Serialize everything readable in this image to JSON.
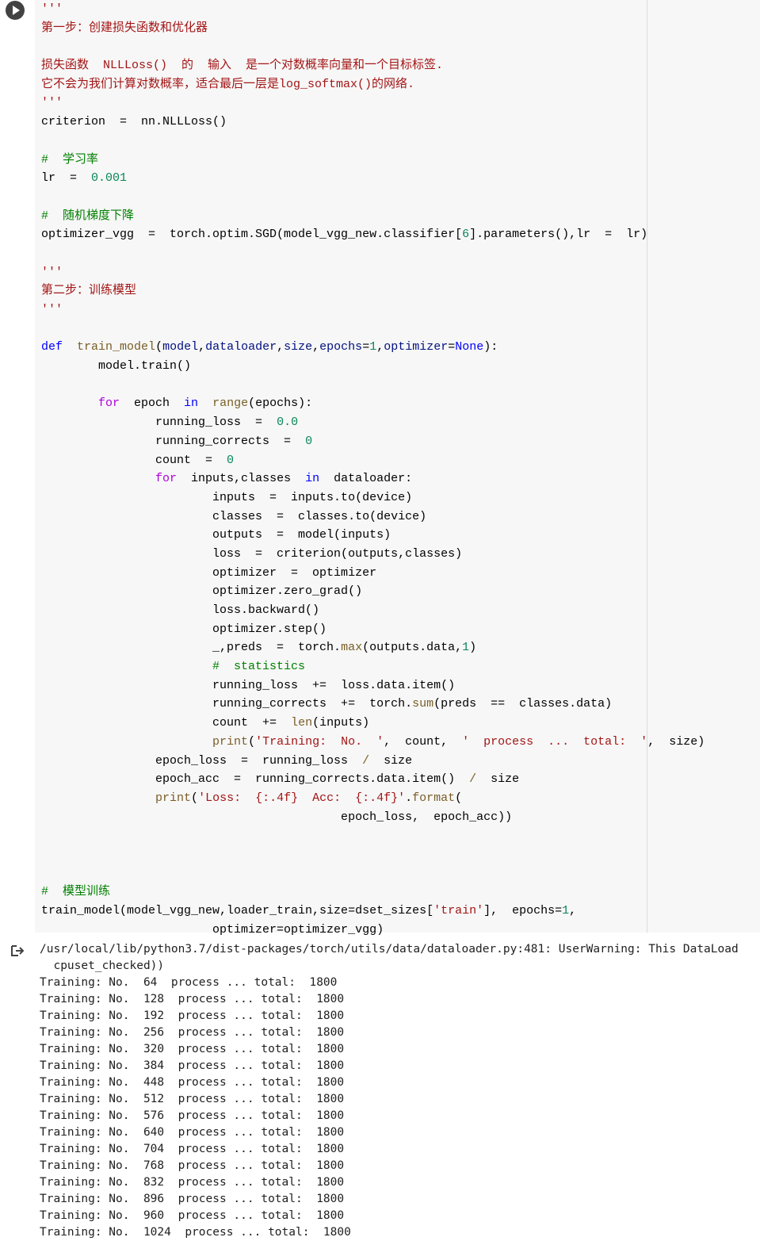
{
  "cell": {
    "run_label": "run",
    "lines": [
      [
        {
          "t": "'''",
          "c": "str"
        }
      ],
      [
        {
          "t": "第一步：创建损失函数和优化器",
          "c": "str"
        }
      ],
      [
        {
          "t": "",
          "c": ""
        }
      ],
      [
        {
          "t": "损失函数  NLLLoss()  的  输入  是一个对数概率向量和一个目标标签.",
          "c": "str"
        }
      ],
      [
        {
          "t": "它不会为我们计算对数概率，适合最后一层是log_softmax()的网络.",
          "c": "str"
        }
      ],
      [
        {
          "t": "'''",
          "c": "str"
        }
      ],
      [
        {
          "t": "criterion  =  nn.NLLLoss()",
          "c": ""
        }
      ],
      [
        {
          "t": "",
          "c": ""
        }
      ],
      [
        {
          "t": "#  学习率",
          "c": "cm"
        }
      ],
      [
        {
          "t": "lr  =  ",
          "c": ""
        },
        {
          "t": "0.001",
          "c": "num"
        }
      ],
      [
        {
          "t": "",
          "c": ""
        }
      ],
      [
        {
          "t": "#  随机梯度下降",
          "c": "cm"
        }
      ],
      [
        {
          "t": "optimizer_vgg  =  torch.optim.SGD(model_vgg_new.classifier[",
          "c": ""
        },
        {
          "t": "6",
          "c": "num"
        },
        {
          "t": "].parameters(),lr  =  lr)",
          "c": ""
        }
      ],
      [
        {
          "t": "",
          "c": ""
        }
      ],
      [
        {
          "t": "'''",
          "c": "str"
        }
      ],
      [
        {
          "t": "第二步：训练模型",
          "c": "str"
        }
      ],
      [
        {
          "t": "'''",
          "c": "str"
        }
      ],
      [
        {
          "t": "",
          "c": ""
        }
      ],
      [
        {
          "t": "def",
          "c": "kw"
        },
        {
          "t": "  ",
          "c": ""
        },
        {
          "t": "train_model",
          "c": "fn"
        },
        {
          "t": "(",
          "c": ""
        },
        {
          "t": "model",
          "c": "par"
        },
        {
          "t": ",",
          "c": ""
        },
        {
          "t": "dataloader",
          "c": "par"
        },
        {
          "t": ",",
          "c": ""
        },
        {
          "t": "size",
          "c": "par"
        },
        {
          "t": ",",
          "c": ""
        },
        {
          "t": "epochs",
          "c": "par"
        },
        {
          "t": "=",
          "c": ""
        },
        {
          "t": "1",
          "c": "num"
        },
        {
          "t": ",",
          "c": ""
        },
        {
          "t": "optimizer",
          "c": "par"
        },
        {
          "t": "=",
          "c": ""
        },
        {
          "t": "None",
          "c": "kw"
        },
        {
          "t": "):",
          "c": ""
        }
      ],
      [
        {
          "t": "        model.train()",
          "c": ""
        }
      ],
      [
        {
          "t": "",
          "c": ""
        }
      ],
      [
        {
          "t": "        ",
          "c": ""
        },
        {
          "t": "for",
          "c": "kw2"
        },
        {
          "t": "  epoch  ",
          "c": ""
        },
        {
          "t": "in",
          "c": "kw"
        },
        {
          "t": "  ",
          "c": ""
        },
        {
          "t": "range",
          "c": "fn"
        },
        {
          "t": "(epochs):",
          "c": ""
        }
      ],
      [
        {
          "t": "                running_loss  =  ",
          "c": ""
        },
        {
          "t": "0.0",
          "c": "num"
        }
      ],
      [
        {
          "t": "                running_corrects  =  ",
          "c": ""
        },
        {
          "t": "0",
          "c": "num"
        }
      ],
      [
        {
          "t": "                count  =  ",
          "c": ""
        },
        {
          "t": "0",
          "c": "num"
        }
      ],
      [
        {
          "t": "                ",
          "c": ""
        },
        {
          "t": "for",
          "c": "kw2"
        },
        {
          "t": "  inputs,classes  ",
          "c": ""
        },
        {
          "t": "in",
          "c": "kw"
        },
        {
          "t": "  dataloader:",
          "c": ""
        }
      ],
      [
        {
          "t": "                        inputs  =  inputs.to(device)",
          "c": ""
        }
      ],
      [
        {
          "t": "                        classes  =  classes.to(device)",
          "c": ""
        }
      ],
      [
        {
          "t": "                        outputs  =  model(inputs)",
          "c": ""
        }
      ],
      [
        {
          "t": "                        loss  =  criterion(outputs,classes)",
          "c": ""
        }
      ],
      [
        {
          "t": "                        optimizer  =  optimizer",
          "c": ""
        }
      ],
      [
        {
          "t": "                        optimizer.zero_grad()",
          "c": ""
        }
      ],
      [
        {
          "t": "                        loss.backward()",
          "c": ""
        }
      ],
      [
        {
          "t": "                        optimizer.step()",
          "c": ""
        }
      ],
      [
        {
          "t": "                        _,preds  =  torch.",
          "c": ""
        },
        {
          "t": "max",
          "c": "fn"
        },
        {
          "t": "(outputs.data,",
          "c": ""
        },
        {
          "t": "1",
          "c": "num"
        },
        {
          "t": ")",
          "c": ""
        }
      ],
      [
        {
          "t": "                        #  statistics",
          "c": "cm"
        }
      ],
      [
        {
          "t": "                        running_loss  +=  loss.data.item()",
          "c": ""
        }
      ],
      [
        {
          "t": "                        running_corrects  +=  torch.",
          "c": ""
        },
        {
          "t": "sum",
          "c": "fn"
        },
        {
          "t": "(preds  ==  classes.data)",
          "c": ""
        }
      ],
      [
        {
          "t": "                        count  +=  ",
          "c": ""
        },
        {
          "t": "len",
          "c": "fn"
        },
        {
          "t": "(inputs)",
          "c": ""
        }
      ],
      [
        {
          "t": "                        ",
          "c": ""
        },
        {
          "t": "print",
          "c": "fn"
        },
        {
          "t": "(",
          "c": ""
        },
        {
          "t": "'Training:  No.  '",
          "c": "str"
        },
        {
          "t": ",  count,  ",
          "c": ""
        },
        {
          "t": "'  process  ...  total:  '",
          "c": "str"
        },
        {
          "t": ",  size)",
          "c": ""
        }
      ],
      [
        {
          "t": "                epoch_loss  =  running_loss  ",
          "c": ""
        },
        {
          "t": "/",
          "c": "fn"
        },
        {
          "t": "  size",
          "c": ""
        }
      ],
      [
        {
          "t": "                epoch_acc  =  running_corrects.data.item()  ",
          "c": ""
        },
        {
          "t": "/",
          "c": "fn"
        },
        {
          "t": "  size",
          "c": ""
        }
      ],
      [
        {
          "t": "                ",
          "c": ""
        },
        {
          "t": "print",
          "c": "fn"
        },
        {
          "t": "(",
          "c": ""
        },
        {
          "t": "'Loss:  {:.4f}  Acc:  {:.4f}'",
          "c": "str"
        },
        {
          "t": ".",
          "c": ""
        },
        {
          "t": "format",
          "c": "fn"
        },
        {
          "t": "(",
          "c": ""
        }
      ],
      [
        {
          "t": "                                          epoch_loss,  epoch_acc))",
          "c": ""
        }
      ],
      [
        {
          "t": "",
          "c": ""
        }
      ],
      [
        {
          "t": "",
          "c": ""
        }
      ],
      [
        {
          "t": "",
          "c": ""
        }
      ],
      [
        {
          "t": "#  模型训练",
          "c": "cm"
        }
      ],
      [
        {
          "t": "train_model(model_vgg_new,loader_train,size=dset_sizes[",
          "c": ""
        },
        {
          "t": "'train'",
          "c": "str"
        },
        {
          "t": "],  epochs=",
          "c": ""
        },
        {
          "t": "1",
          "c": "num"
        },
        {
          "t": ",",
          "c": ""
        }
      ],
      [
        {
          "t": "                        optimizer=optimizer_vgg)",
          "c": ""
        }
      ]
    ]
  },
  "output": {
    "icon": "output-redirect-icon",
    "lines": [
      "/usr/local/lib/python3.7/dist-packages/torch/utils/data/dataloader.py:481: UserWarning: This DataLoad",
      "  cpuset_checked))",
      "Training: No.  64  process ... total:  1800",
      "Training: No.  128  process ... total:  1800",
      "Training: No.  192  process ... total:  1800",
      "Training: No.  256  process ... total:  1800",
      "Training: No.  320  process ... total:  1800",
      "Training: No.  384  process ... total:  1800",
      "Training: No.  448  process ... total:  1800",
      "Training: No.  512  process ... total:  1800",
      "Training: No.  576  process ... total:  1800",
      "Training: No.  640  process ... total:  1800",
      "Training: No.  704  process ... total:  1800",
      "Training: No.  768  process ... total:  1800",
      "Training: No.  832  process ... total:  1800",
      "Training: No.  896  process ... total:  1800",
      "Training: No.  960  process ... total:  1800",
      "Training: No.  1024  process ... total:  1800"
    ]
  }
}
